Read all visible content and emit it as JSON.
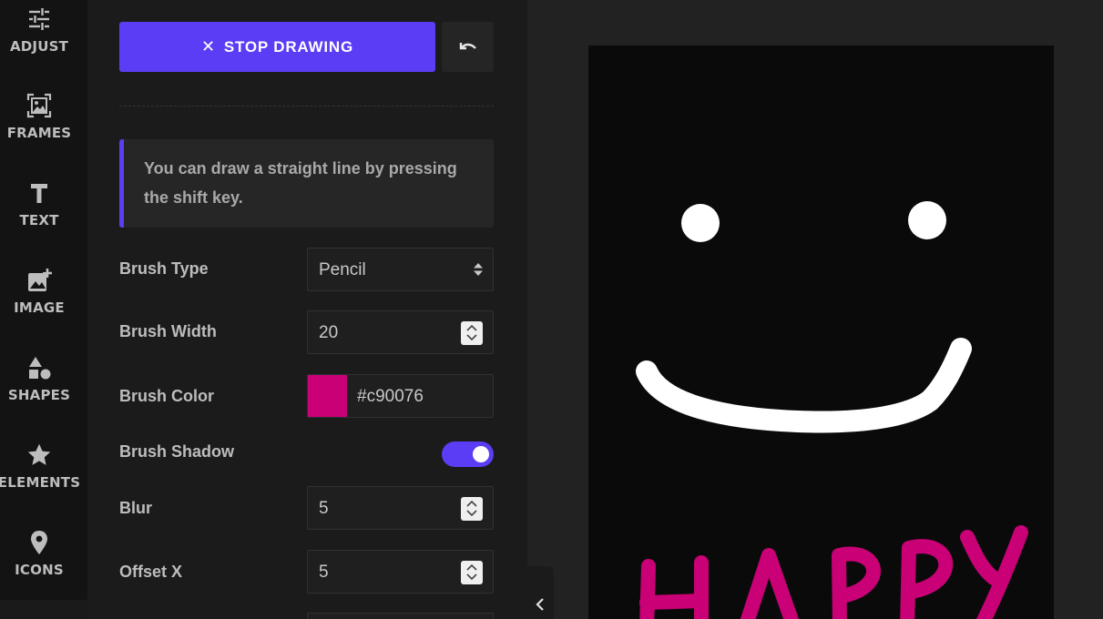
{
  "rail": {
    "items": [
      {
        "label": "ADJUST",
        "icon": "sliders-icon"
      },
      {
        "label": "FRAMES",
        "icon": "frame-image-icon"
      },
      {
        "label": "TEXT",
        "icon": "text-icon"
      },
      {
        "label": "IMAGE",
        "icon": "add-image-icon"
      },
      {
        "label": "SHAPES",
        "icon": "shapes-icon"
      },
      {
        "label": "ELEMENTS",
        "icon": "star-icon"
      },
      {
        "label": "ICONS",
        "icon": "map-pin-icon"
      }
    ]
  },
  "panel": {
    "stop_label": "STOP DRAWING",
    "hint": "You can draw a straight line by pressing the shift key.",
    "brush_type": {
      "label": "Brush Type",
      "value": "Pencil"
    },
    "brush_width": {
      "label": "Brush Width",
      "value": "20"
    },
    "brush_color": {
      "label": "Brush Color",
      "value": "#c90076"
    },
    "brush_shadow": {
      "label": "Brush Shadow",
      "enabled": true
    },
    "blur": {
      "label": "Blur",
      "value": "5"
    },
    "offset_x": {
      "label": "Offset X",
      "value": "5"
    }
  },
  "colors": {
    "accent": "#5b3df5",
    "brush": "#c90076"
  }
}
